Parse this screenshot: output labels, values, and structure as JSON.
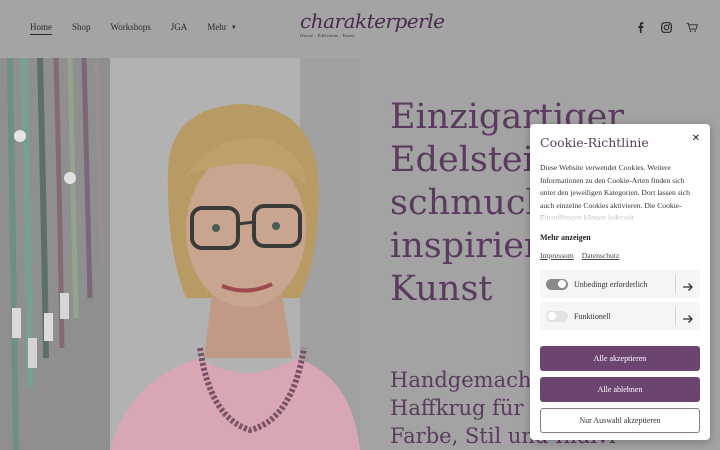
{
  "header": {
    "nav": [
      "Home",
      "Shop",
      "Workshops",
      "JGA",
      "Mehr"
    ],
    "logo_text": "charakterperle",
    "logo_subtitle": "Ostsee · Edelsteine · Kunst",
    "social_icons": [
      "facebook-icon",
      "instagram-icon",
      "cart-icon"
    ]
  },
  "hero": {
    "title": "Einzigartiger\nEdelstein-\nschmuck\ninspiriert\nKunst",
    "subtitle": "Handgemacht in\nHaffkrug für\nFarbe, Stil und Indivi-"
  },
  "cookie": {
    "title": "Cookie-Richtlinie",
    "body": "Diese Website verwendet Cookies. Weitere Informationen zu den Cookie-Arten finden sich unter den jeweiligen Kategorien. Dort lassen sich auch einzelne Cookies aktivieren. Die Cookie-Einstellungen können jederzeit",
    "more_label": "Mehr anzeigen",
    "links": [
      "Impressum",
      "Datenschutz"
    ],
    "categories": [
      {
        "label": "Unbedingt erforderlich",
        "enabled": true
      },
      {
        "label": "Funktionell",
        "enabled": false
      }
    ],
    "buttons": {
      "accept_all": "Alle akzeptieren",
      "reject_all": "Alle ablehnen",
      "accept_selection": "Nur Auswahl akzeptieren"
    }
  },
  "colors": {
    "brand": "#5a3a5e",
    "button": "#6c4470",
    "overlay": "#a4a4a4"
  }
}
